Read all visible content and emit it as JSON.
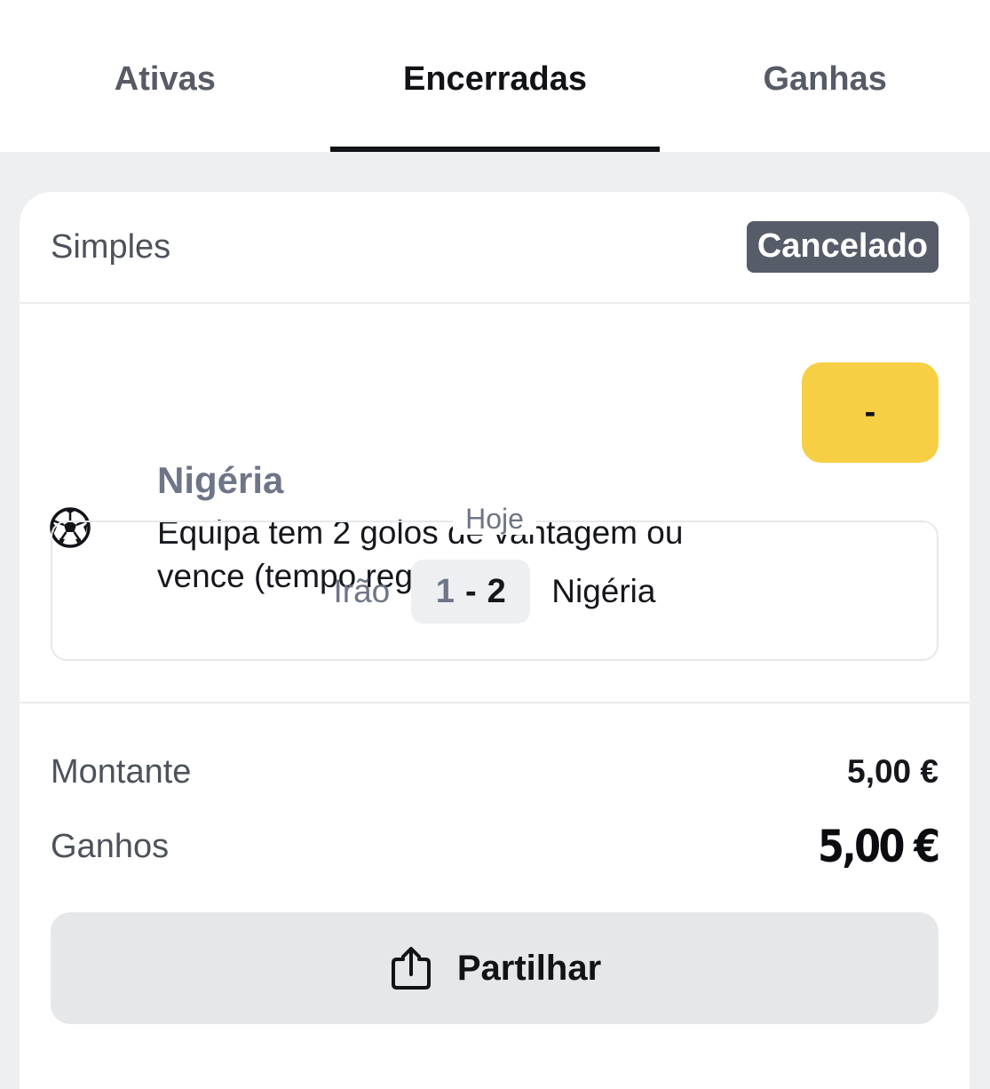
{
  "tabs": [
    {
      "label": "Ativas",
      "active": false
    },
    {
      "label": "Encerradas",
      "active": true
    },
    {
      "label": "Ganhas",
      "active": false
    }
  ],
  "bet": {
    "type": "Simples",
    "status": "Cancelado",
    "status_color": "#565c68"
  },
  "selection": {
    "sport_icon": "soccer-ball-icon",
    "team": "Nigéria",
    "market": "Equipa tem 2 golos de vantagem ou vence (tempo reg.)",
    "odds": "-",
    "odds_color": "#f6cf45"
  },
  "match": {
    "date": "Hoje",
    "home_team": "Irão",
    "home_score": "1",
    "separator": "-",
    "away_score": "2",
    "away_team": "Nigéria"
  },
  "summary": {
    "stake_label": "Montante",
    "stake_value": "5,00 €",
    "payout_label": "Ganhos",
    "payout_value": "5,00 €"
  },
  "share": {
    "label": "Partilhar",
    "icon": "share-icon"
  }
}
